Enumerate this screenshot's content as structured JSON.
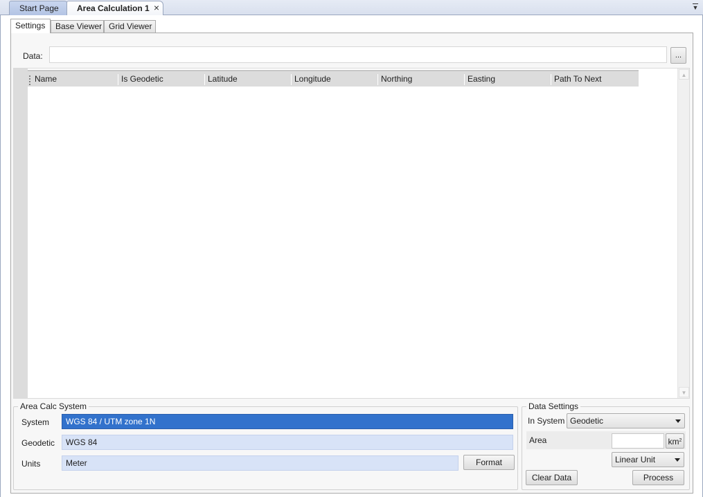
{
  "document_tabs": [
    {
      "label": "Start Page"
    },
    {
      "label": "Area Calculation 1",
      "close_icon": "×"
    }
  ],
  "tab_menu_icon": "chevron-down",
  "inner_tabs": [
    {
      "label": "Settings"
    },
    {
      "label": "Base Viewer"
    },
    {
      "label": "Grid Viewer"
    }
  ],
  "data_row": {
    "label": "Data:",
    "value": "",
    "browse_label": "..."
  },
  "grid": {
    "columns": [
      "Name",
      "Is Geodetic",
      "Latitude",
      "Longitude",
      "Northing",
      "Easting",
      "Path To Next"
    ],
    "rows": []
  },
  "area_calc_system": {
    "title": "Area Calc System",
    "system_label": "System",
    "system_value": "WGS 84 / UTM zone 1N",
    "geodetic_label": "Geodetic",
    "geodetic_value": "WGS 84",
    "units_label": "Units",
    "units_value": "Meter",
    "format_button": "Format"
  },
  "data_settings": {
    "title": "Data Settings",
    "in_system_label": "In System",
    "in_system_value": "Geodetic",
    "area_label": "Area",
    "area_value": "",
    "area_unit": "km",
    "area_unit_exp": "2",
    "linear_unit_value": "Linear Unit",
    "clear_button": "Clear Data",
    "process_button": "Process"
  },
  "colors": {
    "selected_field": "#3272cc",
    "readonly_field": "#d8e3f7",
    "header_bg": "#dcdcdc"
  }
}
